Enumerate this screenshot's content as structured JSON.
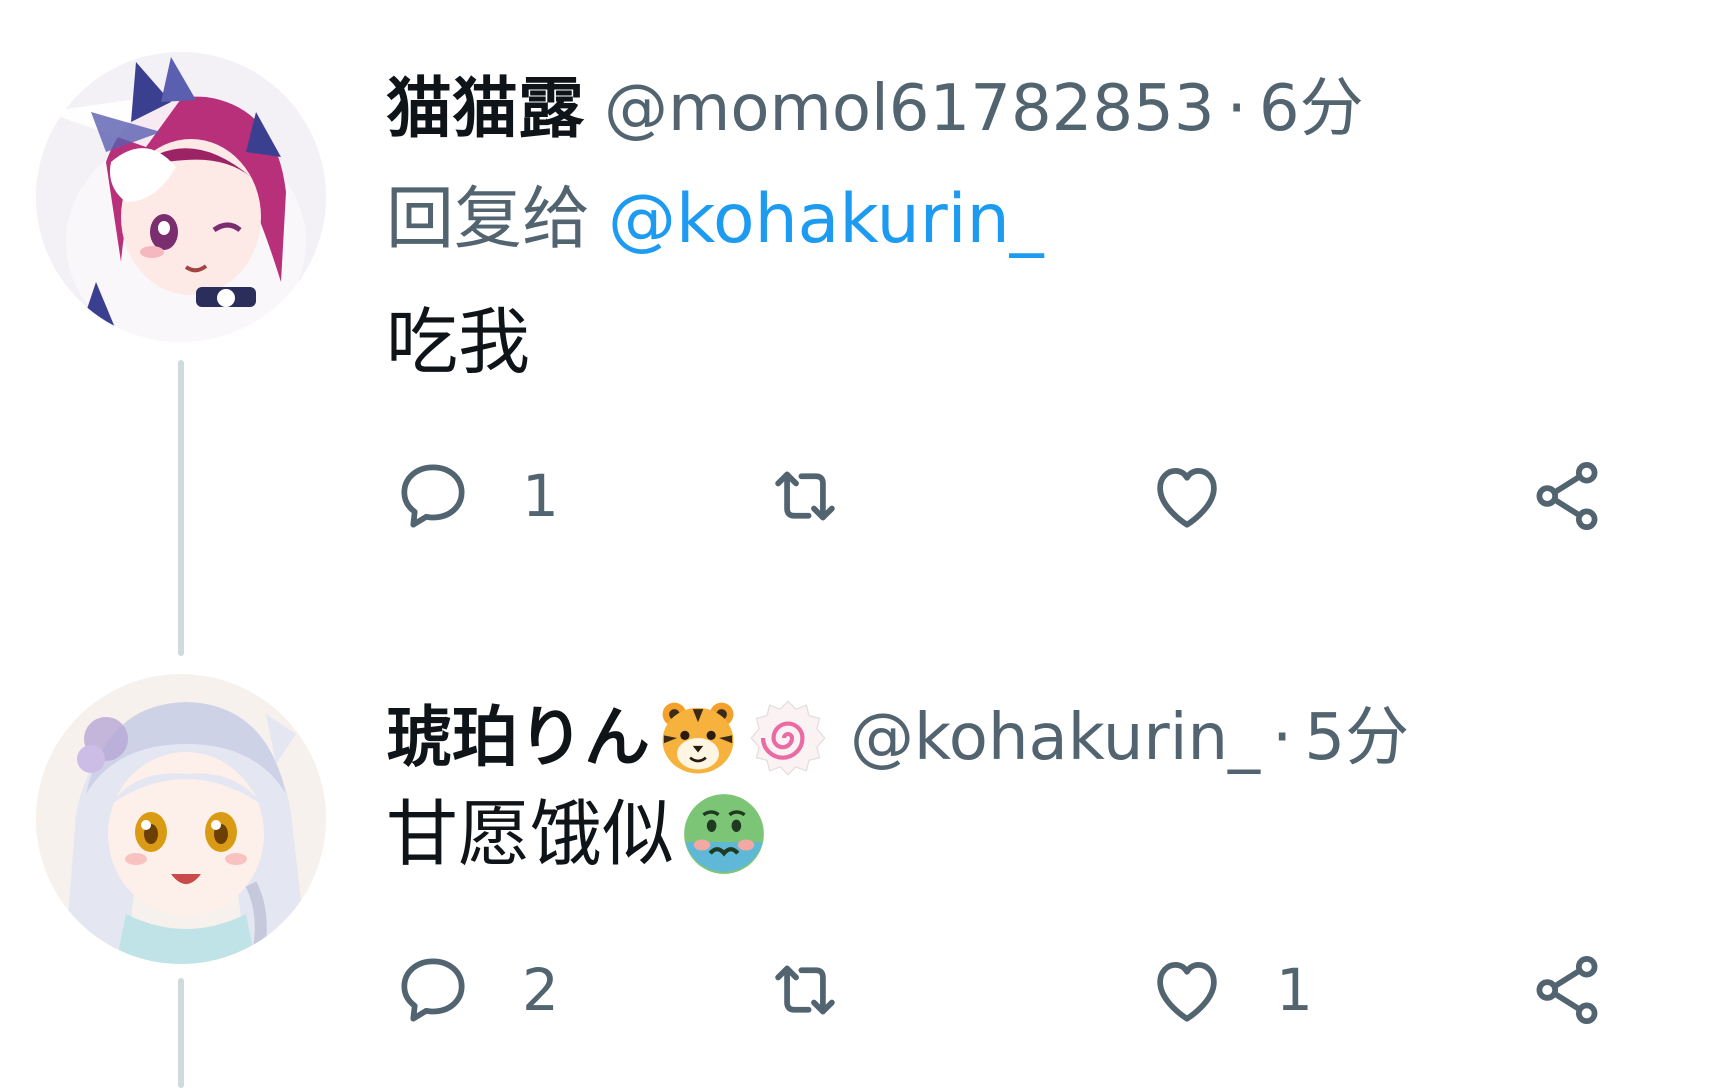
{
  "tweets": [
    {
      "display_name": "猫猫露",
      "handle": "@momol61782853",
      "separator": "·",
      "time": "6分",
      "reply_prefix": "回复给",
      "reply_handle": "@kohakurin_",
      "text": "吃我",
      "actions": {
        "reply_count": "1",
        "retweet_count": "",
        "like_count": "",
        "share_icon": "share-icon"
      },
      "avatar_colors": {
        "hair": "#b8307a",
        "ribbon": "#3a3f8f",
        "bg": "#f3f0f6"
      }
    },
    {
      "display_name": "琥珀りん",
      "name_emojis": [
        "tiger-face-emoji",
        "fish-cake-emoji"
      ],
      "handle": "@kohakurin_",
      "separator": "·",
      "time": "5分",
      "text": "甘愿饿似",
      "text_emoji": "nauseated-face-emoji",
      "actions": {
        "reply_count": "2",
        "retweet_count": "",
        "like_count": "1",
        "share_icon": "share-icon"
      },
      "avatar_colors": {
        "hair": "#e4e6f2",
        "eyes": "#d99a14",
        "bg": "#f6f1ec"
      }
    }
  ],
  "colors": {
    "primary_text": "#0f1419",
    "secondary_text": "#536471",
    "link": "#1d9bf0",
    "thread_line": "#cfd9de",
    "icon": "#536471"
  }
}
